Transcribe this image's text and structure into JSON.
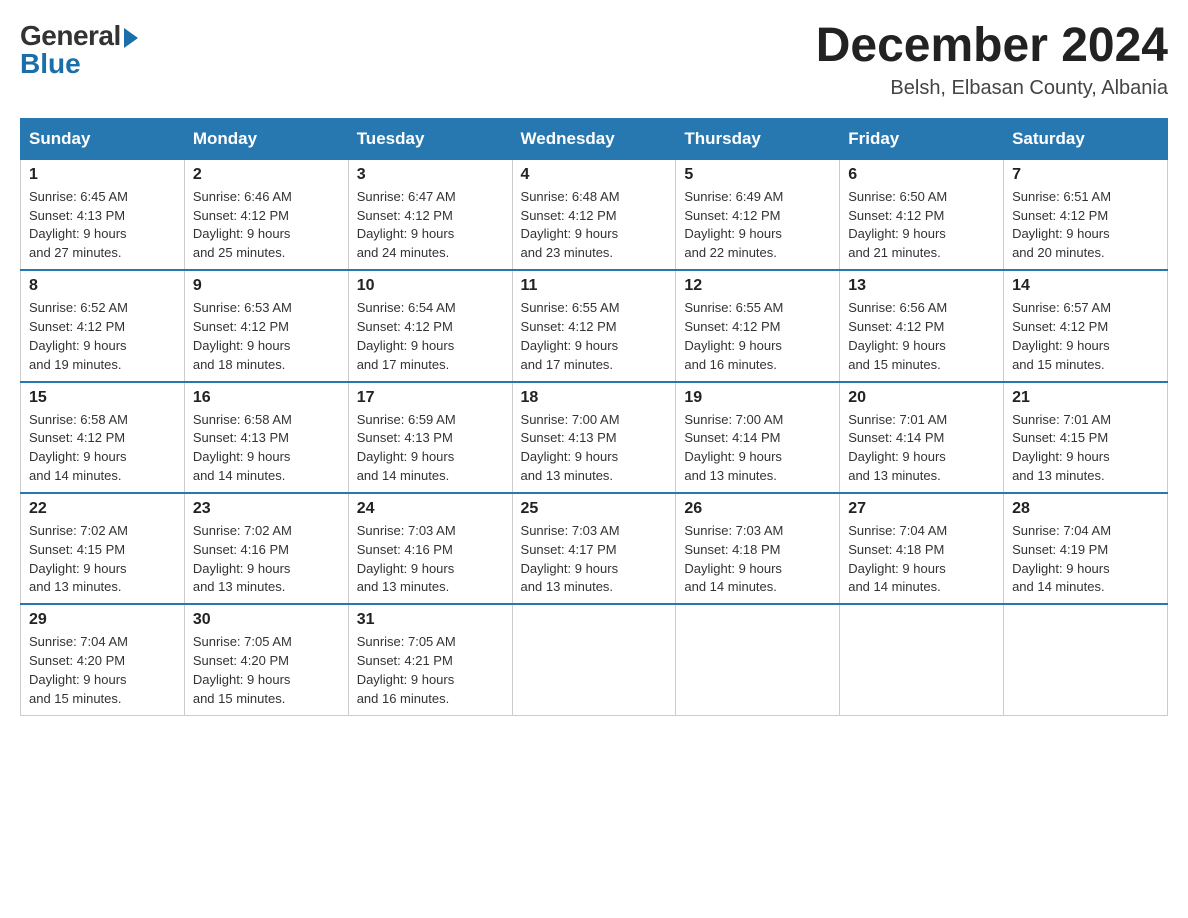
{
  "logo": {
    "general": "General",
    "blue": "Blue"
  },
  "title": {
    "month_year": "December 2024",
    "location": "Belsh, Elbasan County, Albania"
  },
  "days_of_week": [
    "Sunday",
    "Monday",
    "Tuesday",
    "Wednesday",
    "Thursday",
    "Friday",
    "Saturday"
  ],
  "weeks": [
    [
      {
        "day": "1",
        "sunrise": "6:45 AM",
        "sunset": "4:13 PM",
        "daylight": "9 hours and 27 minutes."
      },
      {
        "day": "2",
        "sunrise": "6:46 AM",
        "sunset": "4:12 PM",
        "daylight": "9 hours and 25 minutes."
      },
      {
        "day": "3",
        "sunrise": "6:47 AM",
        "sunset": "4:12 PM",
        "daylight": "9 hours and 24 minutes."
      },
      {
        "day": "4",
        "sunrise": "6:48 AM",
        "sunset": "4:12 PM",
        "daylight": "9 hours and 23 minutes."
      },
      {
        "day": "5",
        "sunrise": "6:49 AM",
        "sunset": "4:12 PM",
        "daylight": "9 hours and 22 minutes."
      },
      {
        "day": "6",
        "sunrise": "6:50 AM",
        "sunset": "4:12 PM",
        "daylight": "9 hours and 21 minutes."
      },
      {
        "day": "7",
        "sunrise": "6:51 AM",
        "sunset": "4:12 PM",
        "daylight": "9 hours and 20 minutes."
      }
    ],
    [
      {
        "day": "8",
        "sunrise": "6:52 AM",
        "sunset": "4:12 PM",
        "daylight": "9 hours and 19 minutes."
      },
      {
        "day": "9",
        "sunrise": "6:53 AM",
        "sunset": "4:12 PM",
        "daylight": "9 hours and 18 minutes."
      },
      {
        "day": "10",
        "sunrise": "6:54 AM",
        "sunset": "4:12 PM",
        "daylight": "9 hours and 17 minutes."
      },
      {
        "day": "11",
        "sunrise": "6:55 AM",
        "sunset": "4:12 PM",
        "daylight": "9 hours and 17 minutes."
      },
      {
        "day": "12",
        "sunrise": "6:55 AM",
        "sunset": "4:12 PM",
        "daylight": "9 hours and 16 minutes."
      },
      {
        "day": "13",
        "sunrise": "6:56 AM",
        "sunset": "4:12 PM",
        "daylight": "9 hours and 15 minutes."
      },
      {
        "day": "14",
        "sunrise": "6:57 AM",
        "sunset": "4:12 PM",
        "daylight": "9 hours and 15 minutes."
      }
    ],
    [
      {
        "day": "15",
        "sunrise": "6:58 AM",
        "sunset": "4:12 PM",
        "daylight": "9 hours and 14 minutes."
      },
      {
        "day": "16",
        "sunrise": "6:58 AM",
        "sunset": "4:13 PM",
        "daylight": "9 hours and 14 minutes."
      },
      {
        "day": "17",
        "sunrise": "6:59 AM",
        "sunset": "4:13 PM",
        "daylight": "9 hours and 14 minutes."
      },
      {
        "day": "18",
        "sunrise": "7:00 AM",
        "sunset": "4:13 PM",
        "daylight": "9 hours and 13 minutes."
      },
      {
        "day": "19",
        "sunrise": "7:00 AM",
        "sunset": "4:14 PM",
        "daylight": "9 hours and 13 minutes."
      },
      {
        "day": "20",
        "sunrise": "7:01 AM",
        "sunset": "4:14 PM",
        "daylight": "9 hours and 13 minutes."
      },
      {
        "day": "21",
        "sunrise": "7:01 AM",
        "sunset": "4:15 PM",
        "daylight": "9 hours and 13 minutes."
      }
    ],
    [
      {
        "day": "22",
        "sunrise": "7:02 AM",
        "sunset": "4:15 PM",
        "daylight": "9 hours and 13 minutes."
      },
      {
        "day": "23",
        "sunrise": "7:02 AM",
        "sunset": "4:16 PM",
        "daylight": "9 hours and 13 minutes."
      },
      {
        "day": "24",
        "sunrise": "7:03 AM",
        "sunset": "4:16 PM",
        "daylight": "9 hours and 13 minutes."
      },
      {
        "day": "25",
        "sunrise": "7:03 AM",
        "sunset": "4:17 PM",
        "daylight": "9 hours and 13 minutes."
      },
      {
        "day": "26",
        "sunrise": "7:03 AM",
        "sunset": "4:18 PM",
        "daylight": "9 hours and 14 minutes."
      },
      {
        "day": "27",
        "sunrise": "7:04 AM",
        "sunset": "4:18 PM",
        "daylight": "9 hours and 14 minutes."
      },
      {
        "day": "28",
        "sunrise": "7:04 AM",
        "sunset": "4:19 PM",
        "daylight": "9 hours and 14 minutes."
      }
    ],
    [
      {
        "day": "29",
        "sunrise": "7:04 AM",
        "sunset": "4:20 PM",
        "daylight": "9 hours and 15 minutes."
      },
      {
        "day": "30",
        "sunrise": "7:05 AM",
        "sunset": "4:20 PM",
        "daylight": "9 hours and 15 minutes."
      },
      {
        "day": "31",
        "sunrise": "7:05 AM",
        "sunset": "4:21 PM",
        "daylight": "9 hours and 16 minutes."
      },
      null,
      null,
      null,
      null
    ]
  ],
  "labels": {
    "sunrise": "Sunrise:",
    "sunset": "Sunset:",
    "daylight": "Daylight:"
  },
  "colors": {
    "header_bg": "#2778b0",
    "header_text": "#ffffff",
    "border": "#cccccc"
  }
}
